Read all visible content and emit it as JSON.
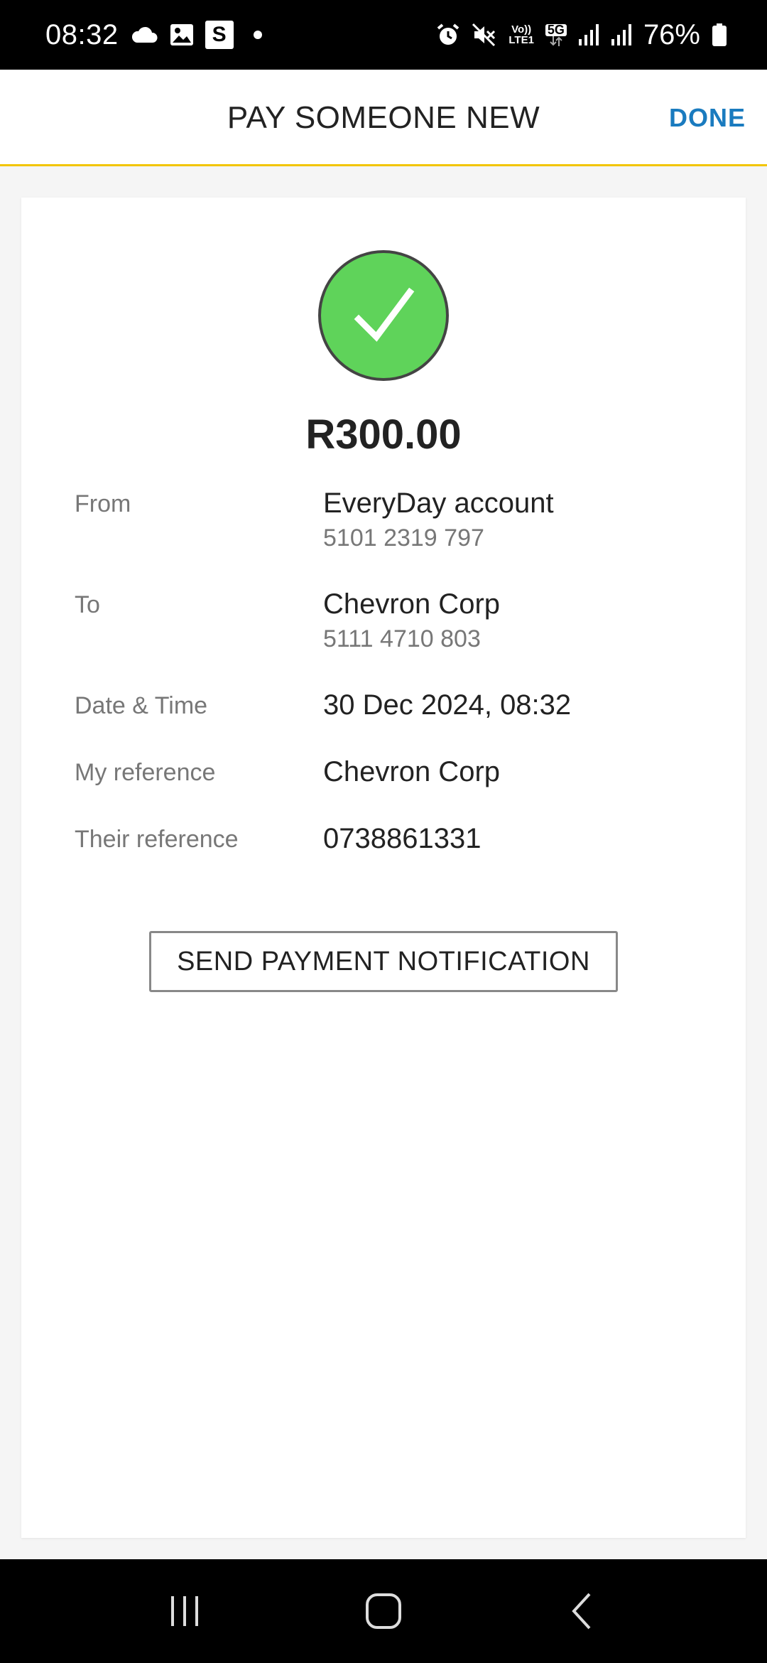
{
  "status_bar": {
    "time": "08:32",
    "left_icons": [
      "cloud-icon",
      "image-icon",
      "s-app-icon",
      "notification-dot"
    ],
    "s_badge_text": "S",
    "right_icons": [
      "alarm-icon",
      "mute-icon",
      "volte-icon",
      "5g-icon",
      "signal-icon",
      "signal-icon",
      "battery-icon"
    ],
    "volte_text_top": "Vo))",
    "volte_text_bottom": "LTE1",
    "net_text": "5G",
    "battery_percent": "76%"
  },
  "header": {
    "title": "PAY SOMEONE NEW",
    "done_label": "DONE",
    "accent_color": "#f2c500",
    "done_color": "#1a7bbf"
  },
  "receipt": {
    "success_icon": "checkmark-icon",
    "success_color": "#5fd35a",
    "amount": "R300.00",
    "from": {
      "label": "From",
      "value": "EveryDay account",
      "account": "5101 2319 797"
    },
    "to": {
      "label": "To",
      "value": "Chevron Corp",
      "account": "5111 4710 803"
    },
    "datetime": {
      "label": "Date & Time",
      "value": "30 Dec 2024, 08:32"
    },
    "my_reference": {
      "label": "My reference",
      "value": "Chevron Corp"
    },
    "their_reference": {
      "label": "Their reference",
      "value": "0738861331"
    },
    "notify_button": "SEND PAYMENT NOTIFICATION"
  },
  "nav_bar": {
    "buttons": [
      "recent-apps-icon",
      "home-icon",
      "back-icon"
    ]
  }
}
